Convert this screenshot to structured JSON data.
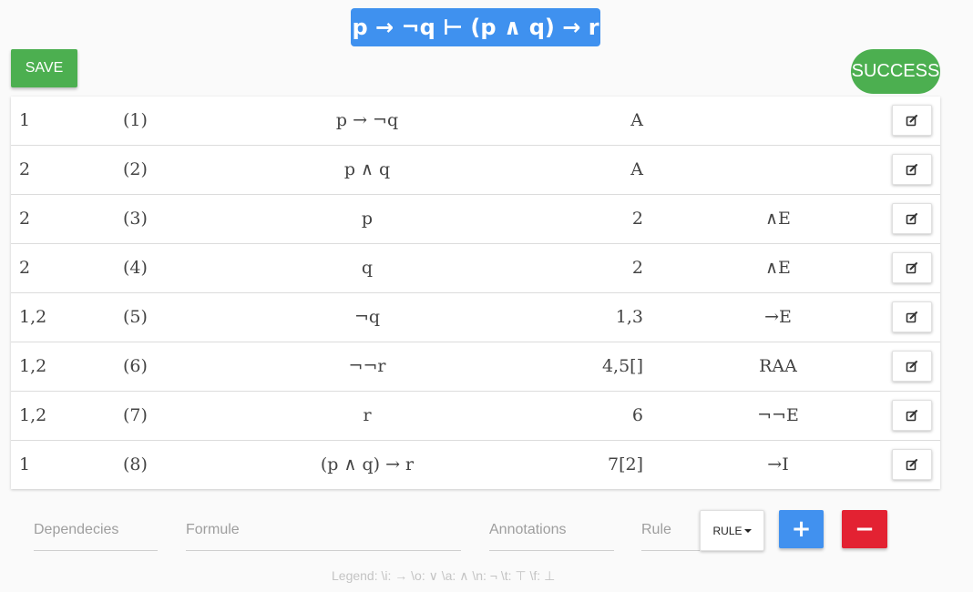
{
  "title": "p → ¬q ⊢ (p ∧ q) → r",
  "save_label": "SAVE",
  "status_label": "SUCCESS",
  "rows": [
    {
      "dep": "1",
      "num": "(1)",
      "formula": "p → ¬q",
      "annotation": "A",
      "rule": ""
    },
    {
      "dep": "2",
      "num": "(2)",
      "formula": "p ∧ q",
      "annotation": "A",
      "rule": ""
    },
    {
      "dep": "2",
      "num": "(3)",
      "formula": "p",
      "annotation": "2",
      "rule": "∧E"
    },
    {
      "dep": "2",
      "num": "(4)",
      "formula": "q",
      "annotation": "2",
      "rule": "∧E"
    },
    {
      "dep": "1,2",
      "num": "(5)",
      "formula": "¬q",
      "annotation": "1,3",
      "rule": "→E"
    },
    {
      "dep": "1,2",
      "num": "(6)",
      "formula": "¬¬r",
      "annotation": "4,5[]",
      "rule": "RAA"
    },
    {
      "dep": "1,2",
      "num": "(7)",
      "formula": "r",
      "annotation": "6",
      "rule": "¬¬E"
    },
    {
      "dep": "1",
      "num": "(8)",
      "formula": "(p ∧ q) → r",
      "annotation": "7[2]",
      "rule": "→I"
    }
  ],
  "form": {
    "dependencies_placeholder": "Dependecies",
    "formula_placeholder": "Formule",
    "annotations_placeholder": "Annotations",
    "rule_placeholder": "Rule",
    "rule_dropdown_label": "RULE",
    "add_label": "+",
    "remove_label": "−"
  },
  "legend": "Legend:  \\i: →   \\o: ∨   \\a: ∧   \\n: ¬   \\t: ⊤   \\f: ⊥",
  "icons": {
    "edit": "edit-icon",
    "caret": "caret-down-icon"
  },
  "colors": {
    "primary": "#3f91ef",
    "success": "#4caf50",
    "danger": "#e32232"
  }
}
